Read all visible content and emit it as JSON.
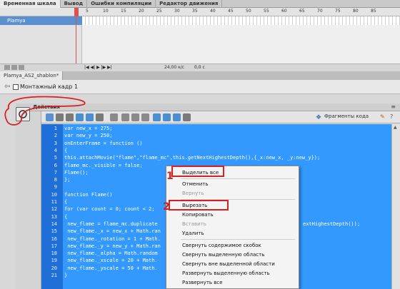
{
  "timeline": {
    "tabs": [
      "Временная шкала",
      "Вывод",
      "Ошибки компиляции",
      "Редактор движения"
    ],
    "layer_name": "Plamya",
    "ruler_numbers": [
      "5",
      "10",
      "15",
      "20",
      "25",
      "30",
      "35",
      "40",
      "45",
      "50",
      "55",
      "60",
      "65",
      "70",
      "75",
      "80",
      "85"
    ],
    "fps": "24,00 к/с",
    "time": "0,0 с"
  },
  "document": {
    "tab_label": "Plamya_AS2_shablon*",
    "scene_label": "Монтажный кадр 1"
  },
  "actions": {
    "title": "Действия",
    "snippets_label": "Фрагменты кода",
    "line_numbers": [
      "1",
      "2",
      "3",
      "4",
      "5",
      "6",
      "7",
      "8",
      "9",
      "10",
      "11",
      "12",
      "13",
      "14",
      "15",
      "16",
      "17",
      "18",
      "19",
      "20",
      "21"
    ],
    "code_lines": [
      "var new_x = 275;",
      "var new_y = 250;",
      "onEnterFrame = function ()",
      "{",
      "this.attachMovie(\"flame\",\"flame_mc\",this.getNextHighestDepth(),{_x:new_x, _y:new_y});",
      "flame_mc._visible = false;",
      "Flame();",
      "};",
      "",
      "function Flame()",
      "{",
      "for (var count = 0; count < 2;",
      "{",
      " new_flame = flame_mc.duplicate",
      " new_flame._x = new_x + Math.ran",
      " new_flame._rotation = 1 + Math.",
      " new_flame._y = new_y + Math.ran",
      " new_flame._alpha = Math.random",
      " new_flame._xscale = 20 + Math.",
      " new_flame._yscale = 50 + Math.",
      "}"
    ],
    "code_overflow_right": "extHighestDepth());"
  },
  "context_menu": {
    "items": [
      {
        "label": "Выделить все",
        "disabled": false
      },
      {
        "label": "Отменить",
        "disabled": false
      },
      {
        "label": "Вернуть",
        "disabled": true
      },
      {
        "label": "Вырезать",
        "disabled": false
      },
      {
        "label": "Копировать",
        "disabled": false
      },
      {
        "label": "Вставить",
        "disabled": true
      },
      {
        "label": "Удалить",
        "disabled": false
      },
      {
        "label": "Свернуть содержимое скобок",
        "disabled": false
      },
      {
        "label": "Свернуть выделенную область",
        "disabled": false
      },
      {
        "label": "Свернуть вне выделенной области",
        "disabled": false
      },
      {
        "label": "Развернуть выделенную область",
        "disabled": false
      },
      {
        "label": "Развернуть все",
        "disabled": false
      }
    ]
  },
  "annotations": {
    "step1": "1",
    "step2": "2"
  },
  "colors": {
    "selection": "#3399ff",
    "annotation_red": "#d82020",
    "layer_highlight": "#5a8fd0"
  }
}
